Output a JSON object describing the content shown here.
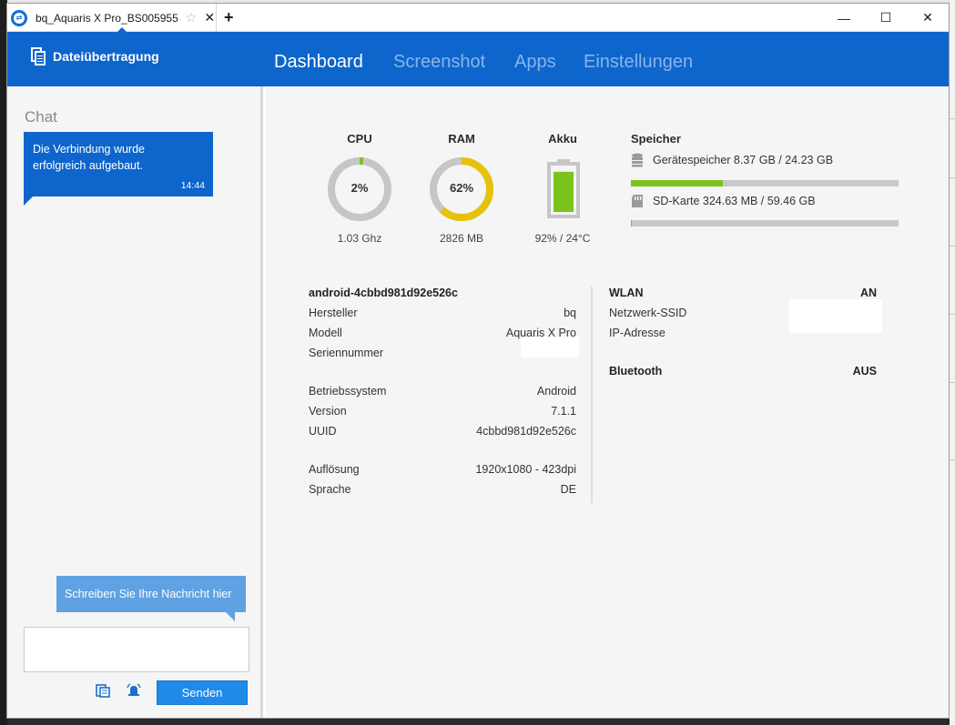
{
  "window": {
    "tab_title": "bq_Aquaris X Pro_BS005955",
    "star_icon": "star-icon",
    "close_tab": "✕",
    "add_tab": "+",
    "controls": {
      "minimize": "—",
      "maximize": "☐",
      "close": "✕"
    }
  },
  "header": {
    "file_transfer_label": "Dateiübertragung",
    "tabs": [
      {
        "label": "Dashboard",
        "active": true
      },
      {
        "label": "Screenshot",
        "active": false
      },
      {
        "label": "Apps",
        "active": false
      },
      {
        "label": "Einstellungen",
        "active": false
      }
    ]
  },
  "chat": {
    "title": "Chat",
    "messages": [
      {
        "text_line1": "Die Verbindung wurde",
        "text_line2": "erfolgreich aufgebaut.",
        "time": "14:44"
      }
    ],
    "compose_hint": "Schreiben Sie Ihre Nachricht hier",
    "input_value": "",
    "send_label": "Senden"
  },
  "dashboard": {
    "cpu": {
      "label": "CPU",
      "value": "2%",
      "percent": 2,
      "sub": "1.03 Ghz",
      "color": "#7cc21c"
    },
    "ram": {
      "label": "RAM",
      "value": "62%",
      "percent": 62,
      "sub": "2826 MB",
      "color": "#e6c20c"
    },
    "battery": {
      "label": "Akku",
      "percent": 92,
      "sub": "92% / 24°C",
      "color": "#7cc21c"
    },
    "storage": {
      "title": "Speicher",
      "items": [
        {
          "label": "Gerätespeicher 8.37 GB / 24.23 GB",
          "fraction": 0.345,
          "icon": "database-icon"
        },
        {
          "label": "SD-Karte 324.63 MB / 59.46 GB",
          "fraction": 0.005,
          "icon": "sd-card-icon"
        }
      ]
    },
    "device": {
      "name": "android-4cbbd981d92e526c",
      "rows": [
        {
          "k": "Hersteller",
          "v": "bq"
        },
        {
          "k": "Modell",
          "v": "Aquaris X Pro"
        },
        {
          "k": "Seriennummer",
          "v": ""
        },
        {
          "k": "Betriebssystem",
          "v": "Android"
        },
        {
          "k": "Version",
          "v": "7.1.1"
        },
        {
          "k": "UUID",
          "v": "4cbbd981d92e526c"
        },
        {
          "k": "Auflösung",
          "v": "1920x1080 - 423dpi"
        },
        {
          "k": "Sprache",
          "v": "DE"
        }
      ]
    },
    "network": {
      "wlan_label": "WLAN",
      "wlan_value": "AN",
      "ssid_label": "Netzwerk-SSID",
      "ip_label": "IP-Adresse",
      "bt_label": "Bluetooth",
      "bt_value": "AUS"
    }
  }
}
